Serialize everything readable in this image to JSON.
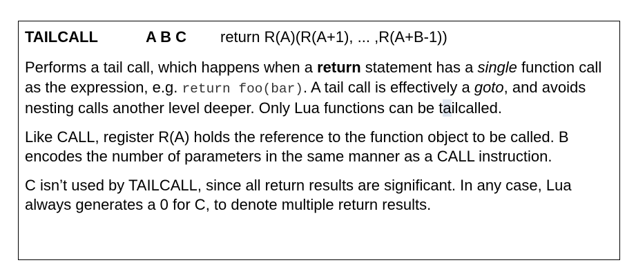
{
  "instruction": {
    "opcode": "TAILCALL",
    "operands": "A B C",
    "description": "return R(A)(R(A+1), ... ,R(A+B-1))"
  },
  "paragraphs": {
    "p1": {
      "t1": "Performs a tail call, which happens when a ",
      "b1": "return",
      "t2": " statement has a ",
      "i1": "single",
      "t3": " function call as the expression, e.g. ",
      "code": "return foo(bar)",
      "t4": ". A tail call is effectively a ",
      "i2": "goto",
      "t5": ", and avoids nesting calls another level deeper. Only Lua functions can be t",
      "hl": "a",
      "t6": "ilcalled."
    },
    "p2": "Like CALL, register R(A) holds the reference to the function object to be called. B encodes the number of parameters in the same manner as a CALL instruction.",
    "p3": "C isn’t used by TAILCALL, since all return results are significant. In any case, Lua always generates a 0 for C, to denote multiple return results."
  }
}
